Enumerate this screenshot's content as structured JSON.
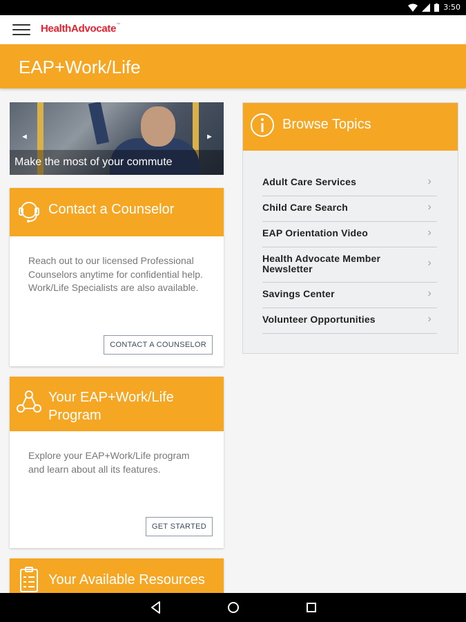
{
  "status": {
    "time": "3:50"
  },
  "appbar": {
    "brand": "HealthAdvocate",
    "brand_mark": "™"
  },
  "page": {
    "title": "EAP+Work/Life"
  },
  "hero": {
    "caption": "Make the most of your commute",
    "prev": "◄",
    "next": "►"
  },
  "cards": [
    {
      "title": "Contact a Counselor",
      "text": "Reach out to our licensed Professional Counselors anytime for confidential help. Work/Life Specialists are also available.",
      "button": "CONTACT A COUNSELOR"
    },
    {
      "title": "Your EAP+Work/Life Program",
      "text": "Explore your EAP+Work/Life program and learn about all its features.",
      "button": "GET STARTED"
    },
    {
      "title": "Your Available Resources"
    }
  ],
  "browse": {
    "title": "Browse Topics",
    "items": [
      {
        "label": "Adult Care Services"
      },
      {
        "label": "Child Care Search"
      },
      {
        "label": "EAP Orientation Video"
      },
      {
        "label": "Health Advocate Member Newsletter"
      },
      {
        "label": "Savings Center"
      },
      {
        "label": "Volunteer Opportunities"
      }
    ]
  },
  "colors": {
    "accent": "#f5a623",
    "brand": "#e4222f"
  }
}
